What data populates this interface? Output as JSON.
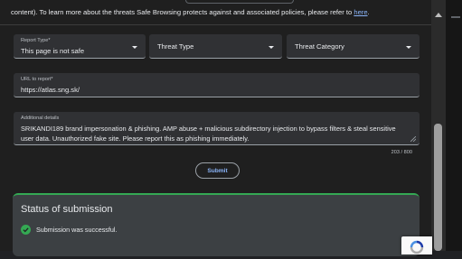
{
  "intro": {
    "text": "content). To learn more about the threats Safe Browsing protects against and associated policies, please refer to ",
    "link": "here",
    "end": "."
  },
  "report_type": {
    "label": "Report Type*",
    "value": "This page is not safe"
  },
  "threat_type": {
    "placeholder": "Threat Type"
  },
  "threat_category": {
    "placeholder": "Threat Category"
  },
  "url_field": {
    "label": "URL to report*",
    "value": "https://atlas.sng.sk/"
  },
  "details": {
    "label": "Additional details",
    "value": "SRIKANDI189 brand impersonation & phishing. AMP abuse + malicious subdirectory injection to bypass filters & steal sensitive user data. Unauthorized fake site. Please report this as phishing immediately.",
    "counter": "203 / 800"
  },
  "submit_label": "Submit",
  "status": {
    "title": "Status of submission",
    "message": "Submission was successful."
  },
  "colors": {
    "accent": "#8ab4f8",
    "success": "#34a853",
    "background": "#1f1f1f",
    "field": "#303134"
  }
}
